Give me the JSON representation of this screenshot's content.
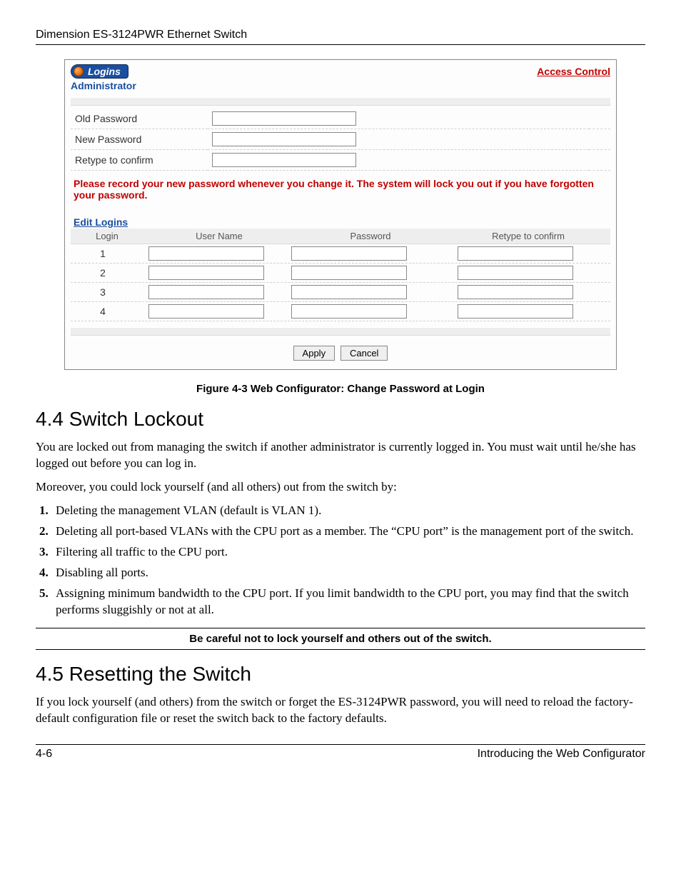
{
  "doc_header": "Dimension ES-3124PWR Ethernet Switch",
  "screenshot": {
    "badge_text": "Logins",
    "access_link": "Access Control",
    "admin_label": "Administrator",
    "fields": {
      "old_pwd": "Old Password",
      "new_pwd": "New Password",
      "retype": "Retype to confirm"
    },
    "warning": "Please record your new password whenever you change it. The system will lock you out if you have forgotten your password.",
    "edit_logins_label": "Edit Logins",
    "columns": {
      "login": "Login",
      "user": "User Name",
      "pass": "Password",
      "retype": "Retype to confirm"
    },
    "rows": [
      "1",
      "2",
      "3",
      "4"
    ],
    "buttons": {
      "apply": "Apply",
      "cancel": "Cancel"
    }
  },
  "figure_caption": "Figure 4-3 Web Configurator: Change Password at Login",
  "section_44": {
    "heading": "4.4  Switch Lockout",
    "p1": "You are locked out from managing the switch if another administrator is currently logged in. You must wait until he/she has logged out before you can log in.",
    "p2": "Moreover, you could lock yourself (and all others) out from the switch by:",
    "items": [
      "Deleting the management VLAN (default is VLAN 1).",
      "Deleting all port-based VLANs with the CPU port as a member. The “CPU port” is the management port of the switch.",
      "Filtering all traffic to the CPU port.",
      "Disabling all ports.",
      "Assigning minimum bandwidth to the CPU port. If you limit bandwidth to the CPU port, you may find that the switch performs sluggishly or not at all."
    ],
    "callout": "Be careful not to lock yourself and others out of the switch."
  },
  "section_45": {
    "heading": "4.5  Resetting the Switch",
    "p1": "If you lock yourself (and others) from the switch or forget the ES-3124PWR password, you will need to reload the factory-default configuration file or reset the switch back to the factory defaults."
  },
  "footer": {
    "page": "4-6",
    "title": "Introducing the Web Configurator"
  }
}
